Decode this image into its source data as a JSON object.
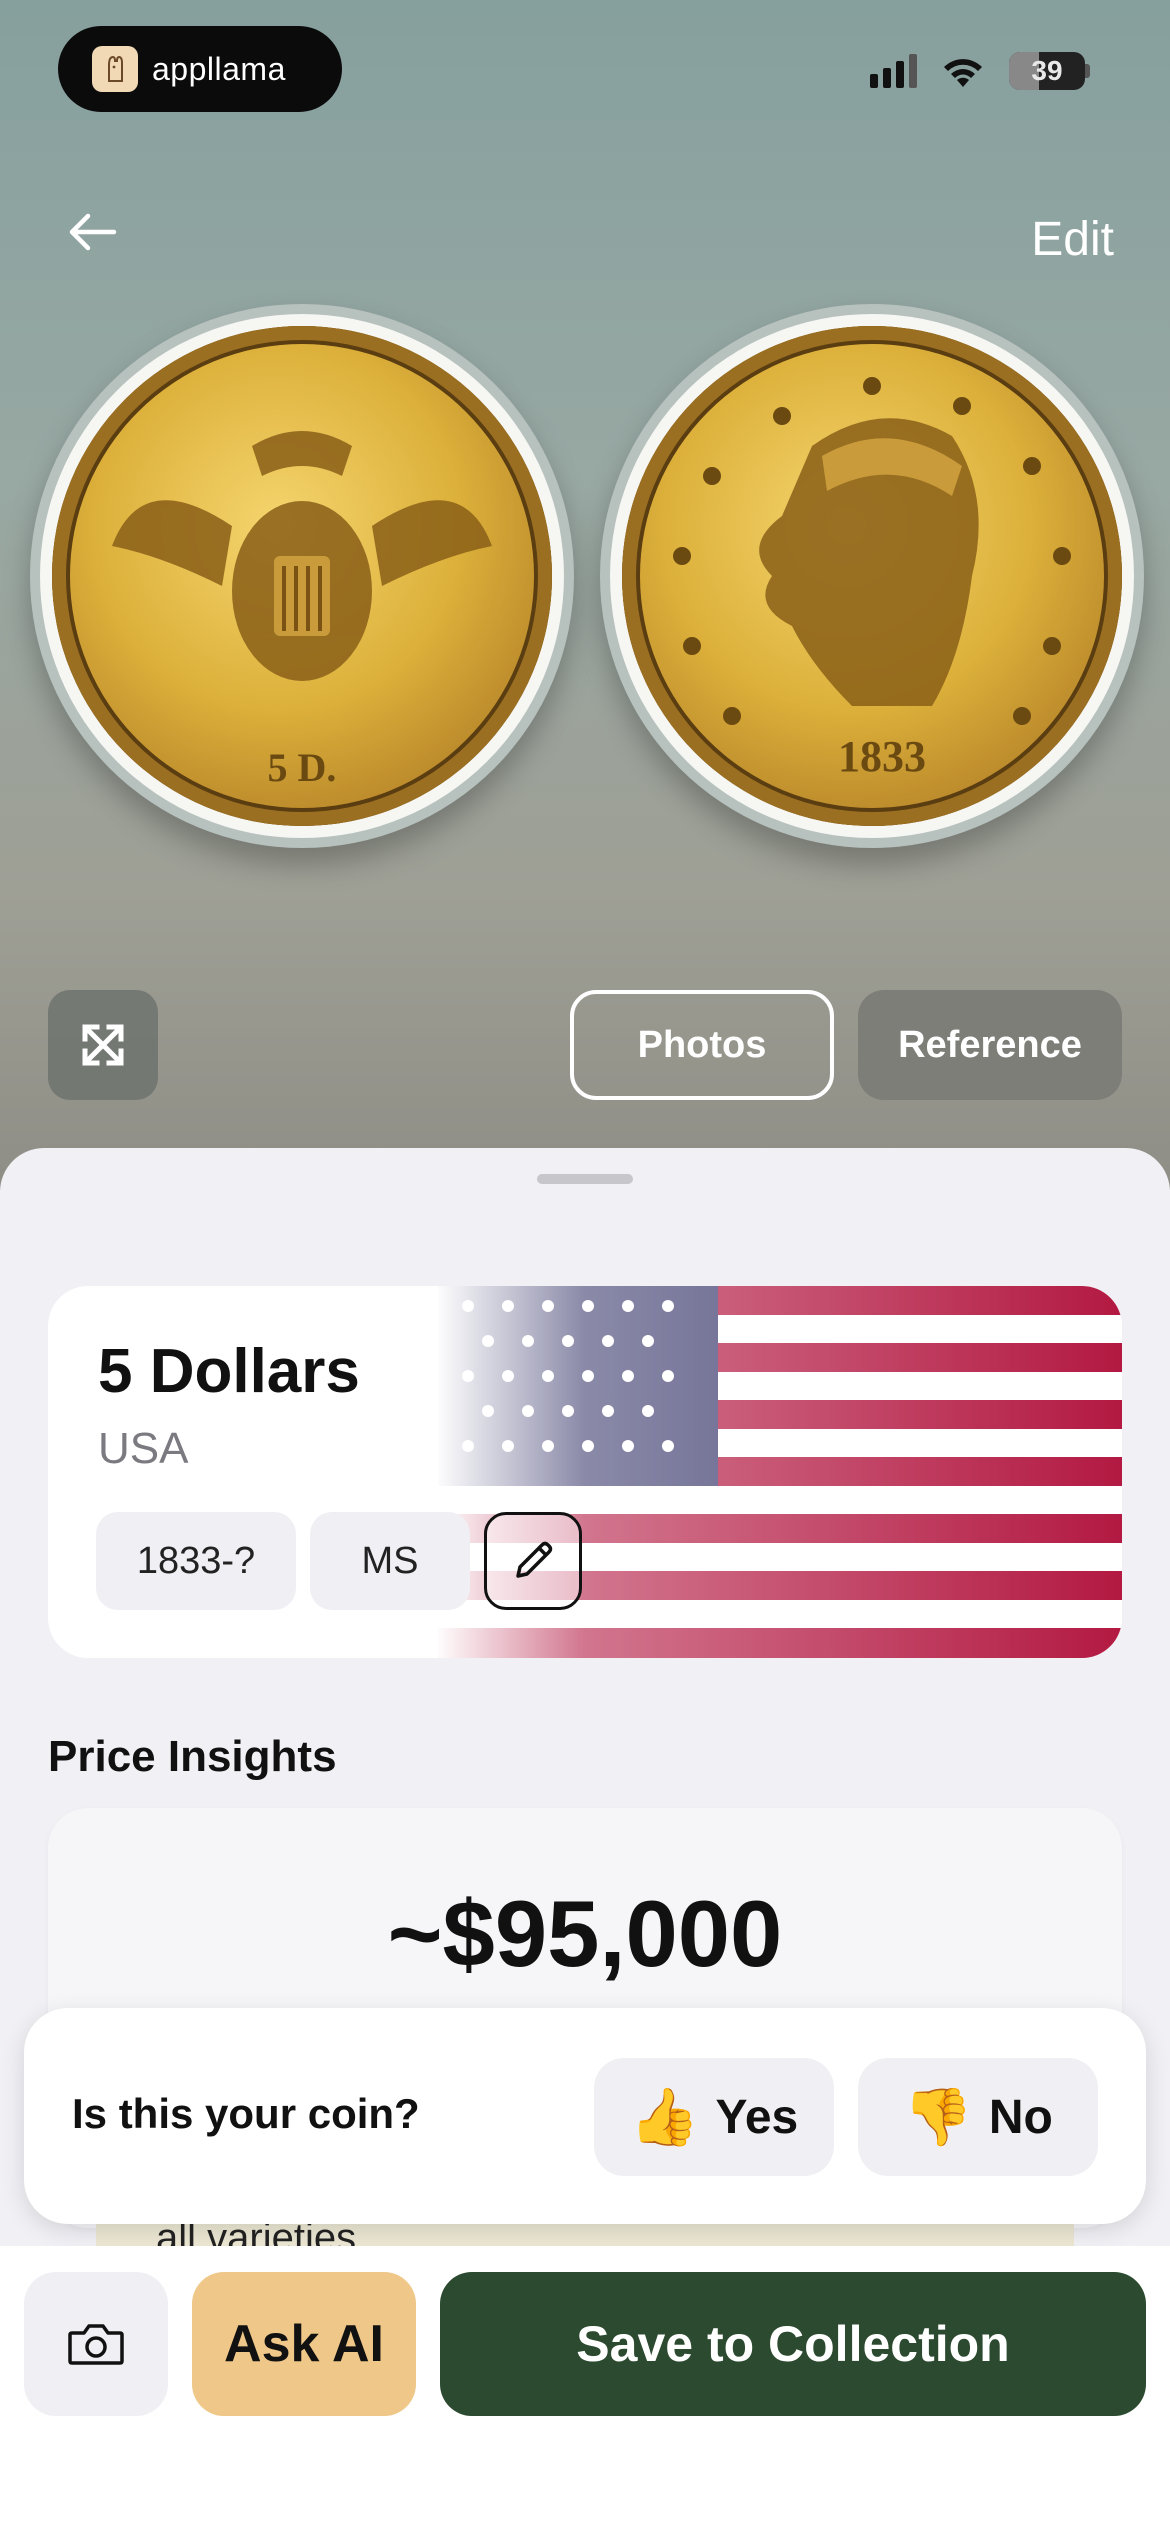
{
  "status_bar": {
    "app_badge_label": "appllama",
    "battery_level": "39",
    "battery_fraction": 0.39
  },
  "header": {
    "back_icon": "arrow-left-icon",
    "edit_label": "Edit"
  },
  "coins": {
    "obverse_date": "1833",
    "reverse_denomination": "5 D."
  },
  "image_controls": {
    "expand_icon": "expand-arrows-icon",
    "photos_label": "Photos",
    "reference_label": "Reference"
  },
  "coin_card": {
    "title": "5 Dollars",
    "country": "USA",
    "year_chip": "1833-?",
    "grade_chip": "MS",
    "edit_icon": "pencil-icon",
    "flag": "usa-flag"
  },
  "price_insights": {
    "section_title": "Price Insights",
    "price": "~$95,000",
    "varieties_text": "all varieties"
  },
  "question": {
    "text": "Is this your coin?",
    "yes_emoji": "👍",
    "yes_label": "Yes",
    "no_emoji": "👎",
    "no_label": "No"
  },
  "bottom_bar": {
    "camera_icon": "camera-icon",
    "ask_ai_label": "Ask AI",
    "save_label": "Save to Collection"
  },
  "colors": {
    "save_button": "#2b4a2f",
    "ask_ai_button": "#efc788",
    "hero_background": "#98a8a3"
  }
}
